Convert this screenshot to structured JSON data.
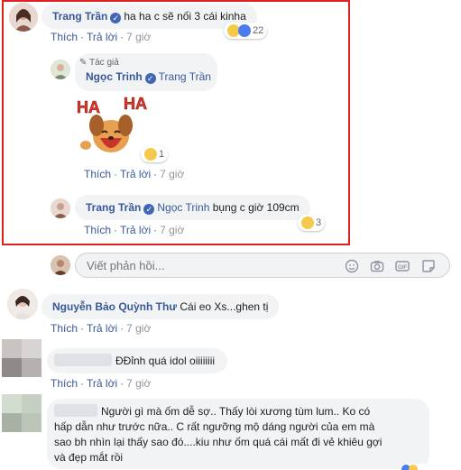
{
  "comments": [
    {
      "author": "Trang Trần",
      "text": "ha ha c sẽ nối 3 cái kinha",
      "actions": [
        "Thích",
        "Trả lời"
      ],
      "time": "7 giờ",
      "reactions": "22"
    },
    {
      "author_badge": "Tác giả",
      "author": "Ngọc Trinh",
      "tagged": "Trang Trần",
      "sticker_text": "HA HA",
      "actions": [
        "Thích",
        "Trả lời"
      ],
      "time": "7 giờ",
      "reactions": "1"
    },
    {
      "author": "Trang Trần",
      "tagged": "Ngọc Trinh",
      "text": "bụng c giờ 109cm",
      "actions": [
        "Thích",
        "Trả lời"
      ],
      "time": "7 giờ",
      "reactions": "3"
    },
    {
      "author": "Nguyễn Bảo Quỳnh Thư",
      "text": "Cái eo Xs...ghen tị",
      "actions": [
        "Thích",
        "Trả lời"
      ],
      "time": "7 giờ"
    },
    {
      "text": "ĐĐỉnh quá idol oiiiiiiii",
      "actions": [
        "Thích",
        "Trả lời"
      ],
      "time": "7 giờ"
    },
    {
      "text_lines": [
        "Người gì mà ốm dễ sợ.. Thấy lòi xương tùm lum.. Ko có",
        "hấp dẫn như trước nữa.. C rất ngưỡng mộ dáng người của em mà",
        "sao bh nhìn lại thấy sao đó....kiu như ốm quá cái mất đi vẻ khiêu gợi",
        "và đẹp mắt rồi"
      ]
    }
  ],
  "reply_box": {
    "placeholder": "Viết phản hồi..."
  },
  "colors": {
    "highlight": "#e02020",
    "link": "#385898",
    "bubble": "#f2f3f5"
  }
}
